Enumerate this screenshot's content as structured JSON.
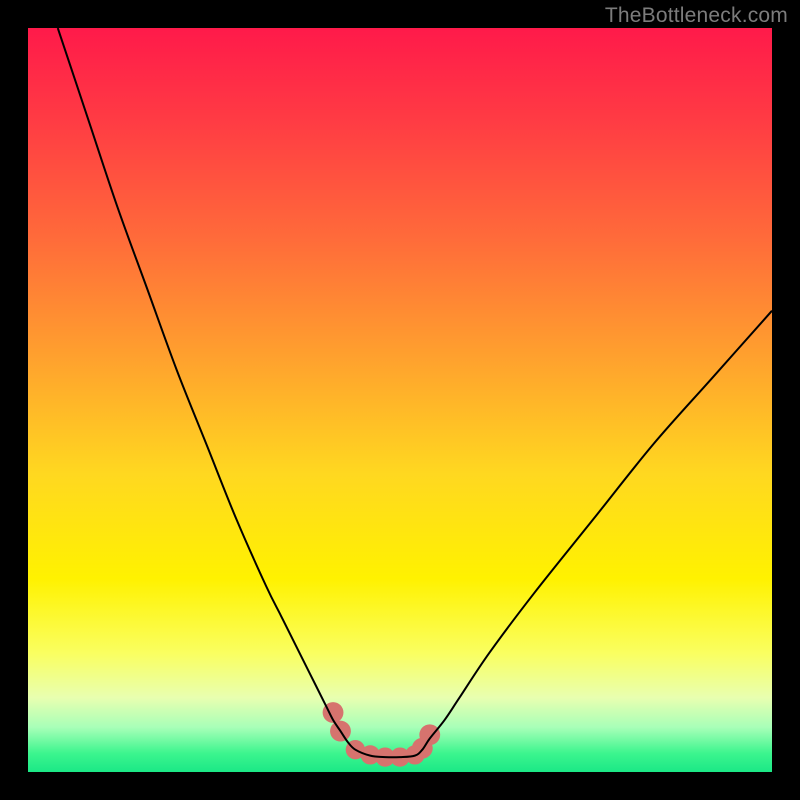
{
  "watermark": "TheBottleneck.com",
  "chart_data": {
    "type": "line",
    "title": "",
    "xlabel": "",
    "ylabel": "",
    "xlim": [
      0,
      100
    ],
    "ylim": [
      0,
      100
    ],
    "grid": false,
    "background_gradient": {
      "stops": [
        {
          "pos": 0.0,
          "color": "#ff1a4a"
        },
        {
          "pos": 0.12,
          "color": "#ff3a44"
        },
        {
          "pos": 0.28,
          "color": "#ff6a3a"
        },
        {
          "pos": 0.44,
          "color": "#ffa02e"
        },
        {
          "pos": 0.6,
          "color": "#ffd820"
        },
        {
          "pos": 0.74,
          "color": "#fff200"
        },
        {
          "pos": 0.84,
          "color": "#faff60"
        },
        {
          "pos": 0.9,
          "color": "#e8ffb0"
        },
        {
          "pos": 0.94,
          "color": "#a8ffb8"
        },
        {
          "pos": 0.975,
          "color": "#3cf58e"
        },
        {
          "pos": 1.0,
          "color": "#1be886"
        }
      ]
    },
    "series": [
      {
        "name": "bottleneck-curve",
        "color": "#000000",
        "x": [
          4,
          8,
          12,
          16,
          20,
          24,
          28,
          32,
          34,
          36,
          38,
          40,
          41,
          42,
          43,
          44,
          46,
          48,
          50,
          52,
          53,
          54,
          56,
          58,
          62,
          68,
          76,
          84,
          92,
          100
        ],
        "y": [
          100,
          88,
          76,
          65,
          54,
          44,
          34,
          25,
          21,
          17,
          13,
          9,
          7,
          5.5,
          4,
          3,
          2.2,
          2,
          2,
          2.2,
          3,
          4.5,
          7,
          10,
          16,
          24,
          34,
          44,
          53,
          62
        ]
      }
    ],
    "markers": [
      {
        "name": "left-edge-dot-upper",
        "x": 41.0,
        "y": 8.0,
        "r": 1.4,
        "color": "#d6736e"
      },
      {
        "name": "left-edge-dot-lower",
        "x": 42.0,
        "y": 5.5,
        "r": 1.4,
        "color": "#d6736e"
      },
      {
        "name": "flat-dot-1",
        "x": 44.0,
        "y": 3.0,
        "r": 1.3,
        "color": "#d6736e"
      },
      {
        "name": "flat-dot-2",
        "x": 46.0,
        "y": 2.3,
        "r": 1.3,
        "color": "#d6736e"
      },
      {
        "name": "flat-dot-3",
        "x": 48.0,
        "y": 2.0,
        "r": 1.3,
        "color": "#d6736e"
      },
      {
        "name": "flat-dot-4",
        "x": 50.0,
        "y": 2.0,
        "r": 1.3,
        "color": "#d6736e"
      },
      {
        "name": "flat-dot-5",
        "x": 52.0,
        "y": 2.3,
        "r": 1.3,
        "color": "#d6736e"
      },
      {
        "name": "right-edge-dot-lower",
        "x": 53.0,
        "y": 3.2,
        "r": 1.4,
        "color": "#d6736e"
      },
      {
        "name": "right-edge-dot-upper",
        "x": 54.0,
        "y": 5.0,
        "r": 1.4,
        "color": "#d6736e"
      }
    ]
  }
}
